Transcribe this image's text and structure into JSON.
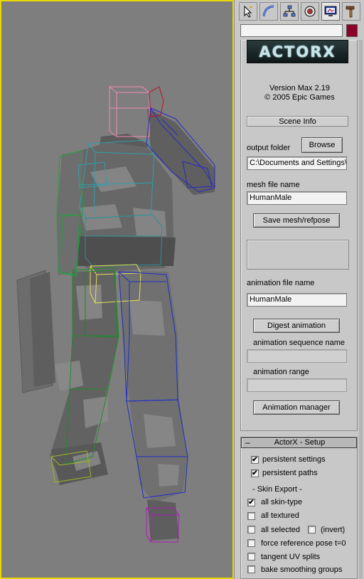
{
  "toolbar": {
    "tabs": [
      {
        "icon": "create-arrow-icon"
      },
      {
        "icon": "modify-curve-icon"
      },
      {
        "icon": "hierarchy-icon"
      },
      {
        "icon": "motion-icon"
      },
      {
        "icon": "display-icon"
      },
      {
        "icon": "utilities-hammer-icon"
      }
    ],
    "active_tab": 4
  },
  "object": {
    "name": "",
    "color": "#8a0028"
  },
  "actorx": {
    "logo_text": "ACTORX",
    "version": "Version Max 2.19",
    "copyright": "© 2005  Epic Games",
    "scene_info_label": "Scene Info",
    "output_folder_label": "output folder",
    "browse_label": "Browse",
    "output_folder_value": "C:\\Documents and Settings\\",
    "mesh_file_label": "mesh file name",
    "mesh_file_value": "HumanMale",
    "save_mesh_label": "Save mesh/refpose",
    "animation_file_label": "animation file name",
    "animation_file_value": "HumanMale",
    "digest_label": "Digest animation",
    "sequence_label": "animation sequence name",
    "sequence_value": "",
    "range_label": "animation range",
    "range_value": "",
    "anim_manager_label": "Animation manager"
  },
  "setup": {
    "collapse_sign": "–",
    "title": "ActorX - Setup",
    "persistent_settings": {
      "label": "persistent settings",
      "checked": true
    },
    "persistent_paths": {
      "label": "persistent paths",
      "checked": true
    },
    "skin_export_header": "- Skin Export -",
    "all_skin_type": {
      "label": "all skin-type",
      "checked": true
    },
    "all_textured": {
      "label": "all textured",
      "checked": false
    },
    "all_selected": {
      "label": "all selected",
      "checked": false
    },
    "invert": {
      "label": "(invert)",
      "checked": false
    },
    "force_reference_pose": {
      "label": "force reference pose t=0",
      "checked": false
    },
    "tangent_uv_splits": {
      "label": "tangent UV splits",
      "checked": false
    },
    "bake_smoothing_groups": {
      "label": "bake smoothing groups",
      "checked": false
    }
  },
  "colors": {
    "viewport_border": "#e8d800",
    "viewport_bg": "#7e7e7e",
    "panel_bg": "#c8c8c8"
  }
}
